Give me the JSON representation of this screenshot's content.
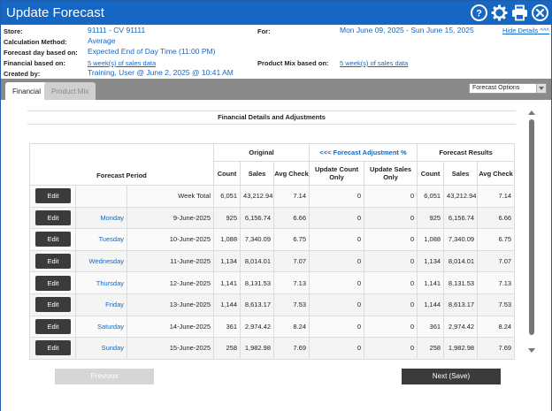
{
  "window": {
    "title": "Update Forecast",
    "colors": {
      "titlebar": "#1667c4",
      "link": "#1667c4",
      "button_dark": "#3b3b3b"
    }
  },
  "info": {
    "store_label": "Store:",
    "store_value": "91111 - CV 91111",
    "for_label": "For:",
    "for_value": "Mon June 09, 2025 - Sun June 15, 2025",
    "hide_details": "Hide Details ^^^",
    "calc_label": "Calculation Method:",
    "calc_value": "Average",
    "forecast_day_label": "Forecast day based on:",
    "forecast_day_value": "Expected End of Day Time (11:00 PM)",
    "financial_label": "Financial based on:",
    "financial_value": "5 week(s) of sales data",
    "product_mix_label": "Product Mix based on:",
    "product_mix_value": "5 week(s) of sales data",
    "created_label": "Created by:",
    "created_value": "Training, User @ June 2, 2025 @ 10:41 AM"
  },
  "tabs": [
    {
      "label": "Financial",
      "active": true
    },
    {
      "label": "Product Mix",
      "active": false
    }
  ],
  "forecast_options": "Forecast Options",
  "section_title": "Financial Details and Adjustments",
  "table": {
    "group_original": "Original",
    "group_adjustment": "<<< Forecast Adjustment %",
    "group_results": "Forecast Results",
    "col_period": "Forecast Period",
    "col_count": "Count",
    "col_sales": "Sales",
    "col_avg": "Avg Check",
    "col_upd_count": "Update Count Only",
    "col_upd_sales": "Update Sales Only",
    "edit_label": "Edit",
    "rows": [
      {
        "day": "",
        "date": "Week Total",
        "count": "6,051",
        "sales": "43,212.94",
        "avg": "7.14",
        "upd_count": "0",
        "upd_sales": "0",
        "r_count": "6,051",
        "r_sales": "43,212.94",
        "r_avg": "7.14"
      },
      {
        "day": "Monday",
        "date": "9-June-2025",
        "count": "925",
        "sales": "6,156.74",
        "avg": "6.66",
        "upd_count": "0",
        "upd_sales": "0",
        "r_count": "925",
        "r_sales": "6,156.74",
        "r_avg": "6.66"
      },
      {
        "day": "Tuesday",
        "date": "10-June-2025",
        "count": "1,088",
        "sales": "7,340.09",
        "avg": "6.75",
        "upd_count": "0",
        "upd_sales": "0",
        "r_count": "1,088",
        "r_sales": "7,340.09",
        "r_avg": "6.75"
      },
      {
        "day": "Wednesday",
        "date": "11-June-2025",
        "count": "1,134",
        "sales": "8,014.01",
        "avg": "7.07",
        "upd_count": "0",
        "upd_sales": "0",
        "r_count": "1,134",
        "r_sales": "8,014.01",
        "r_avg": "7.07"
      },
      {
        "day": "Thursday",
        "date": "12-June-2025",
        "count": "1,141",
        "sales": "8,131.53",
        "avg": "7.13",
        "upd_count": "0",
        "upd_sales": "0",
        "r_count": "1,141",
        "r_sales": "8,131.53",
        "r_avg": "7.13"
      },
      {
        "day": "Friday",
        "date": "13-June-2025",
        "count": "1,144",
        "sales": "8,613.17",
        "avg": "7.53",
        "upd_count": "0",
        "upd_sales": "0",
        "r_count": "1,144",
        "r_sales": "8,613.17",
        "r_avg": "7.53"
      },
      {
        "day": "Saturday",
        "date": "14-June-2025",
        "count": "361",
        "sales": "2,974.42",
        "avg": "8.24",
        "upd_count": "0",
        "upd_sales": "0",
        "r_count": "361",
        "r_sales": "2,974.42",
        "r_avg": "8.24"
      },
      {
        "day": "Sunday",
        "date": "15-June-2025",
        "count": "258",
        "sales": "1,982.98",
        "avg": "7.69",
        "upd_count": "0",
        "upd_sales": "0",
        "r_count": "258",
        "r_sales": "1,982.98",
        "r_avg": "7.69"
      }
    ]
  },
  "buttons": {
    "previous": "Previous",
    "next": "Next (Save)"
  }
}
